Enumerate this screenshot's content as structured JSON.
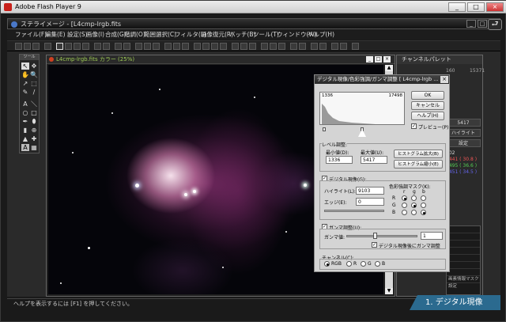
{
  "flash_window": {
    "title": "Adobe Flash Player 9",
    "minimize": "_",
    "maximize": "□",
    "close": "×"
  },
  "app": {
    "title": "ステライメージ - [L4cmp-lrgb.fits",
    "min": "_",
    "max": "□",
    "close": "×",
    "return_glyph": "⮐"
  },
  "menu": [
    "ファイル(F)",
    "編集(E)",
    "設定(S)",
    "画像(I)",
    "合成(G)",
    "階調(O)",
    "範囲選択(C)",
    "フィルタ(L)",
    "画像復元(R)",
    "バッチ(B)",
    "ツール(T)",
    "ウィンドウ(W)",
    "ヘルプ(H)"
  ],
  "toolbox": {
    "title": "ツール",
    "tools": [
      "↖",
      "✥",
      "✋",
      "🔍",
      "↗",
      "⬚",
      "✎",
      "/",
      "A",
      "＼",
      "○",
      "□",
      "✒",
      "⬮",
      "▮",
      "⊕",
      "▲",
      "✚",
      "A",
      "▦"
    ]
  },
  "document": {
    "title": "L4cmp-lrgb.fits カラー (25%)",
    "min": "_",
    "max": "□",
    "close": "×",
    "scroll_up": "▲",
    "scroll_down": "▼"
  },
  "channel_palette": {
    "title": "チャンネルパレット",
    "readout_lines": [
      "160",
      "15371"
    ],
    "field_value": "5417",
    "buttons": [
      "ハイライト",
      "設定"
    ],
    "values": [
      "902",
      "2441 ( 30.8 )",
      "2495 ( 36.6 )",
      "2451 ( 34.5 )"
    ],
    "list_items": [
      "",
      "",
      "",
      "",
      "",
      "",
      "",
      ""
    ],
    "footer": "画素情報マスク設定"
  },
  "dialog": {
    "title": "デジタル現像/色彩強調/ガンマ調整 [ L4cmp-lrgb ...",
    "close": "×",
    "hist_low": "1336",
    "hist_high": "17498",
    "ok": "OK",
    "cancel": "キャンセル",
    "help": "ヘルプ(H)",
    "preview_label": "プレビュー(P)",
    "preview_checked": "✓",
    "level_group": "レベル調整:",
    "min_label": "最小値(D):",
    "max_label": "最大値(U):",
    "min_value": "1336",
    "max_value": "5417",
    "hist_btn1": "ヒストグラム拡大(B)",
    "hist_btn2": "ヒストグラム縮小(E)",
    "dd_check_label": "デジタル現像(G):",
    "dd_checked": "✓",
    "highlight_label": "ハイライト(L):",
    "highlight_value": "9103",
    "edge_label": "エッジ(E):",
    "edge_value": "0",
    "mask_label": "色彩強調マスク(K):",
    "mask_cols": [
      "r",
      "g",
      "b"
    ],
    "mask_rows": [
      "R",
      "G",
      "B"
    ],
    "gamma_check_label": "ガンマ調整(U):",
    "gamma_checked": "✓",
    "gamma_label": "ガンマ値:",
    "gamma_value": "1",
    "after_dd_label": "デジタル現像後にガンマ調整",
    "after_dd_checked": "✓",
    "channel_label": "チャンネル(C):",
    "channels": [
      "RGB",
      "R",
      "G",
      "B"
    ]
  },
  "status": "ヘルプを表示するには [F1] を押してください。",
  "caption": "1. デジタル現像"
}
